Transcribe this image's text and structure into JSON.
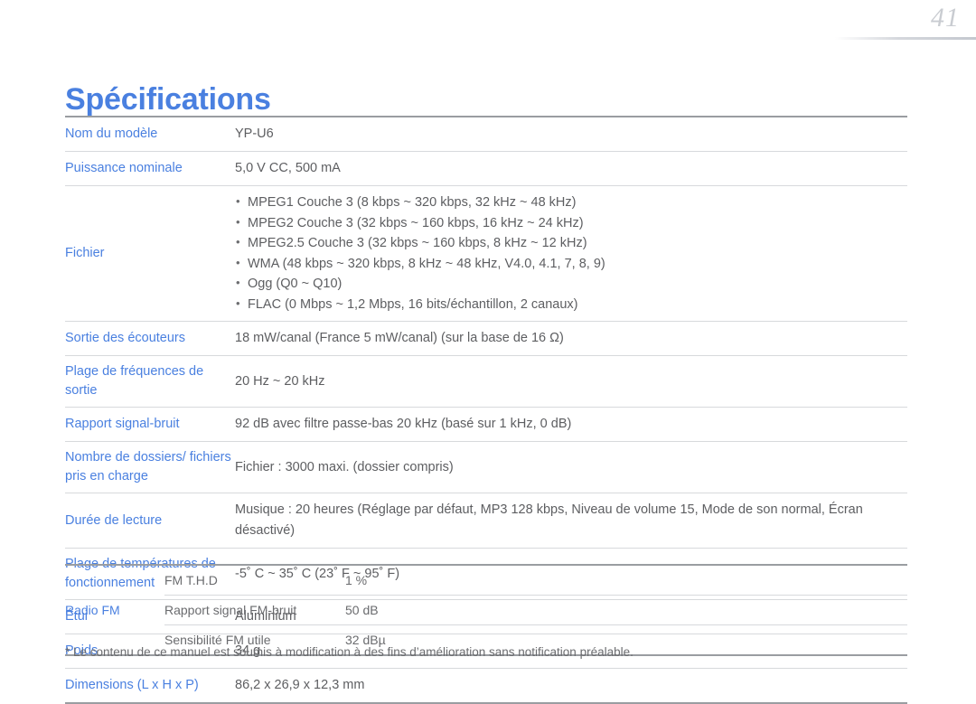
{
  "page": {
    "number": "41",
    "title": "Spécifications"
  },
  "spec_table": {
    "rows": [
      {
        "label": "Nom du modèle",
        "value": "YP-U6"
      },
      {
        "label": "Puissance nominale",
        "value": "5,0 V CC, 500 mA"
      },
      {
        "label": "Fichier",
        "list": [
          "MPEG1 Couche 3 (8 kbps ~ 320 kbps, 32 kHz ~ 48 kHz)",
          "MPEG2 Couche 3 (32 kbps ~ 160 kbps, 16 kHz ~ 24 kHz)",
          "MPEG2.5 Couche 3 (32 kbps ~ 160 kbps, 8 kHz ~ 12 kHz)",
          "WMA (48 kbps ~ 320 kbps, 8 kHz ~ 48 kHz, V4.0, 4.1, 7, 8, 9)",
          "Ogg (Q0 ~ Q10)",
          "FLAC (0 Mbps ~ 1,2 Mbps, 16 bits/échantillon, 2 canaux)"
        ]
      },
      {
        "label": "Sortie des écouteurs",
        "value": "18 mW/canal (France 5 mW/canal) (sur la base de 16 Ω)"
      },
      {
        "label": "Plage de fréquences de sortie",
        "value": "20 Hz ~ 20 kHz"
      },
      {
        "label": "Rapport signal-bruit",
        "value": "92 dB avec filtre passe-bas 20 kHz (basé sur 1 kHz, 0 dB)"
      },
      {
        "label": "Nombre de dossiers/ fichiers pris en charge",
        "value": "Fichier : 3000 maxi. (dossier compris)"
      },
      {
        "label": "Durée de lecture",
        "value": "Musique : 20 heures (Réglage par défaut, MP3 128 kbps, Niveau de volume 15, Mode de son normal, Écran désactivé)"
      },
      {
        "label": "Plage de températures de fonctionnement",
        "value": "-5˚ C ~ 35˚ C (23˚ F ~ 95˚ F)"
      },
      {
        "label": "Étui",
        "value": "Aluminium"
      },
      {
        "label": "Poids",
        "value": "34 g"
      },
      {
        "label": "Dimensions (L x H x P)",
        "value": "86,2 x 26,9 x 12,3 mm"
      }
    ]
  },
  "fm_table": {
    "group_label": "Radio FM",
    "rows": [
      {
        "name": "FM T.H.D",
        "value": "1 %"
      },
      {
        "name": "Rapport signal FM-bruit",
        "value": "50 dB"
      },
      {
        "name": "Sensibilité FM utile",
        "value": "32 dBµ"
      }
    ]
  },
  "footnote": {
    "text": "* Le contenu de ce manuel est soumis à modification à des fins d’amélioration sans notification préalable."
  },
  "colors": {
    "accent_blue": "#4a80e0",
    "body_gray": "#5d5e61",
    "rule_gray": "#d7d9dc",
    "rule_dark": "#9a9da1",
    "page_number_gray": "#c9ccd1"
  }
}
